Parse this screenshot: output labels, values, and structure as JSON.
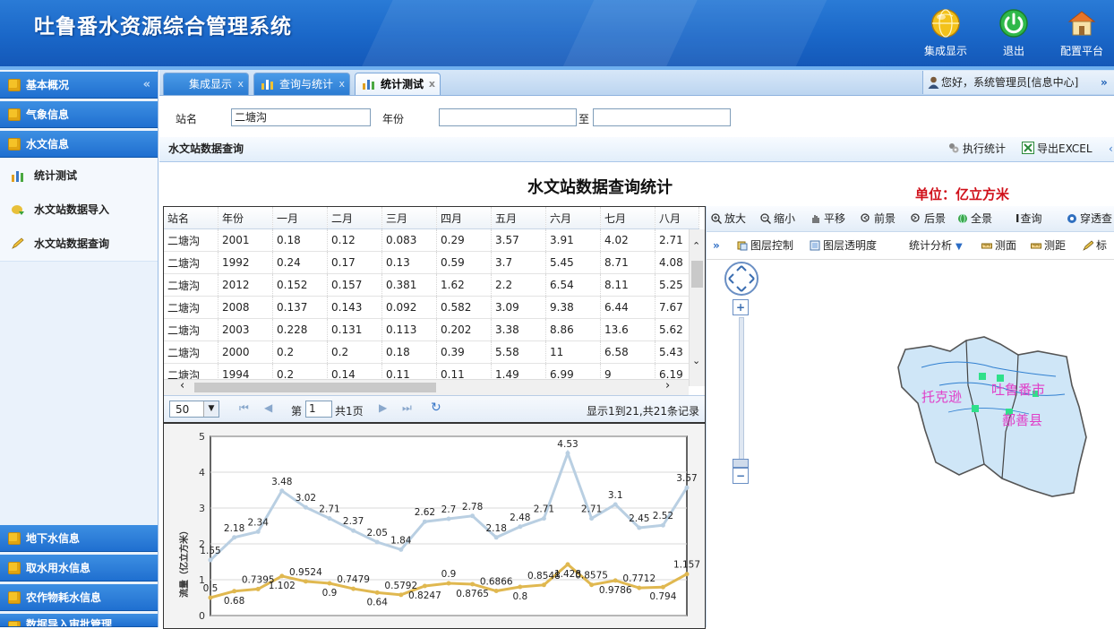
{
  "app": {
    "title": "吐鲁番水资源综合管理系统"
  },
  "header_buttons": [
    {
      "label": "集成显示",
      "icon": "globe-icon"
    },
    {
      "label": "退出",
      "icon": "power-icon"
    },
    {
      "label": "配置平台",
      "icon": "house-icon"
    }
  ],
  "sidebar": {
    "top_sections": [
      {
        "label": "基本概况",
        "chevron": "«"
      },
      {
        "label": "气象信息"
      },
      {
        "label": "水文信息"
      }
    ],
    "items": [
      {
        "label": "统计测试",
        "icon": "bar-chart-icon"
      },
      {
        "label": "水文站数据导入",
        "icon": "import-icon"
      },
      {
        "label": "水文站数据查询",
        "icon": "pencil-icon"
      }
    ],
    "bottom_sections": [
      {
        "label": "地下水信息"
      },
      {
        "label": "取水用水信息"
      },
      {
        "label": "农作物耗水信息"
      },
      {
        "label": "数据导入审批管理"
      }
    ]
  },
  "tabs": [
    {
      "label": "集成显示",
      "close": "x"
    },
    {
      "label": "查询与统计",
      "close": "x"
    },
    {
      "label": "统计测试",
      "close": "x"
    }
  ],
  "user": {
    "greeting": "您好，系统管理员[信息中心]",
    "arrow": "»"
  },
  "form": {
    "station_label": "站名",
    "station_value": "二塘沟",
    "year_label": "年份",
    "year_from": "",
    "to_label": "至",
    "year_to": ""
  },
  "panel": {
    "title": "水文站数据查询",
    "run_label": "执行统计",
    "export_label": "导出EXCEL"
  },
  "report": {
    "title": "水文站数据查询统计",
    "unit": "单位：亿立方米"
  },
  "table": {
    "headers": [
      "站名",
      "年份",
      "一月",
      "二月",
      "三月",
      "四月",
      "五月",
      "六月",
      "七月",
      "八月"
    ],
    "rows": [
      [
        "二塘沟",
        "2001",
        "0.18",
        "0.12",
        "0.083",
        "0.29",
        "3.57",
        "3.91",
        "4.02",
        "2.71"
      ],
      [
        "二塘沟",
        "1992",
        "0.24",
        "0.17",
        "0.13",
        "0.59",
        "3.7",
        "5.45",
        "8.71",
        "4.08"
      ],
      [
        "二塘沟",
        "2012",
        "0.152",
        "0.157",
        "0.381",
        "1.62",
        "2.2",
        "6.54",
        "8.11",
        "5.25"
      ],
      [
        "二塘沟",
        "2008",
        "0.137",
        "0.143",
        "0.092",
        "0.582",
        "3.09",
        "9.38",
        "6.44",
        "7.67"
      ],
      [
        "二塘沟",
        "2003",
        "0.228",
        "0.131",
        "0.113",
        "0.202",
        "3.38",
        "8.86",
        "13.6",
        "5.62"
      ],
      [
        "二塘沟",
        "2000",
        "0.2",
        "0.2",
        "0.18",
        "0.39",
        "5.58",
        "11",
        "6.58",
        "5.43"
      ],
      [
        "二塘沟",
        "1994",
        "0.2",
        "0.14",
        "0.11",
        "0.11",
        "1.49",
        "6.99",
        "9",
        "6.19"
      ]
    ]
  },
  "pager": {
    "page_size": "50",
    "page_label": "第",
    "page_value": "1",
    "total_pages": "共1页",
    "summary": "显示1到21,共21条记录"
  },
  "map": {
    "toolbar1": [
      "放大",
      "缩小",
      "平移",
      "前景",
      "后景",
      "全景",
      "查询",
      "穿透查"
    ],
    "toolbar2": [
      "图层控制",
      "图层透明度",
      "统计分析",
      "测面",
      "测距",
      "标"
    ],
    "labels": {
      "county1": "托克逊",
      "county2": "吐鲁番市",
      "county3": "鄯善县"
    }
  },
  "chart_data": {
    "type": "line",
    "ylabel": "流量（亿立方米）",
    "ylim": [
      0,
      5
    ],
    "yticks": [
      0,
      1,
      2,
      3,
      4,
      5
    ],
    "series": [
      {
        "values": [
          1.55,
          2.18,
          2.34,
          3.48,
          3.02,
          2.71,
          2.37,
          2.05,
          1.84,
          2.62,
          2.7,
          2.78,
          2.18,
          2.48,
          2.71,
          4.53,
          2.71,
          3.1,
          2.45,
          2.52,
          3.57
        ],
        "color": "#b9cfe2"
      },
      {
        "values": [
          0.5,
          0.68,
          0.7395,
          1.102,
          0.9524,
          0.9,
          0.7479,
          0.64,
          0.5792,
          0.8247,
          0.9,
          0.8765,
          0.6866,
          0.8,
          0.8548,
          1.428,
          0.8575,
          0.9786,
          0.7712,
          0.794,
          1.157
        ],
        "color": "#e0b850"
      }
    ],
    "point_labels_series1": [
      "1.55",
      "2.18",
      "2.34",
      "3.48",
      "3.02",
      "2.71",
      "2.37",
      "2.05",
      "1.84",
      "2.62",
      "2.7",
      "2.78",
      "2.18",
      "2.48",
      "2.71",
      "4.53",
      "2.71",
      "3.1",
      "2.45",
      "2.52",
      "3.57"
    ],
    "point_labels_series2": [
      "0.5",
      "0.68",
      "0.7395",
      "1.102",
      "0.9524",
      "0.9",
      "0.7479",
      "0.64",
      "0.5792",
      "0.8247",
      "0.9",
      "0.8765",
      "0.6866",
      "0.8",
      "0.8548",
      "1.428",
      "0.8575",
      "0.9786",
      "0.7712",
      "0.794",
      "1.157"
    ],
    "grid": true
  }
}
